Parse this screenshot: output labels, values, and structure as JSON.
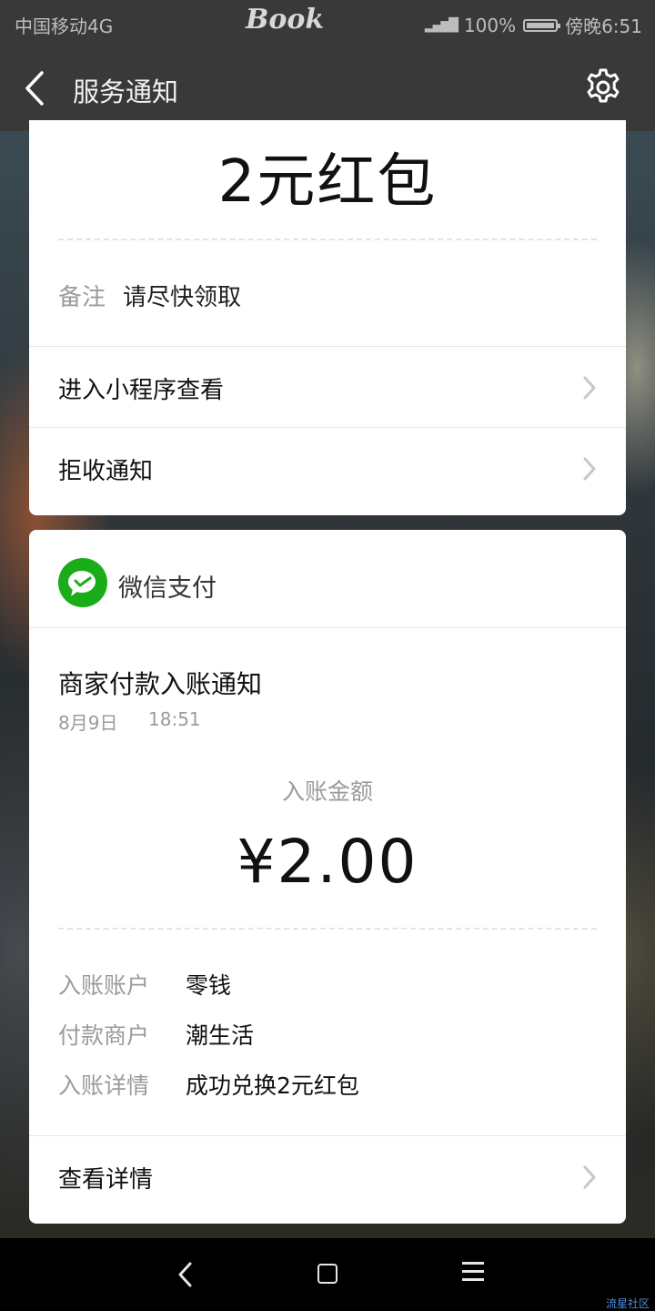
{
  "status_bar": {
    "carrier": "中国移动4G",
    "logo": "Book",
    "battery": "100%",
    "time": "傍晚6:51"
  },
  "title_bar": {
    "title": "服务通知",
    "back_icon": "chevron-left-icon",
    "settings_icon": "gear-icon"
  },
  "card1": {
    "headline": "2元红包",
    "remark_label": "备注",
    "remark_value": "请尽快领取",
    "actions": [
      {
        "label": "进入小程序查看"
      },
      {
        "label": "拒收通知"
      }
    ]
  },
  "card2": {
    "sender": "微信支付",
    "sender_icon": "wechat-pay-icon",
    "title": "商家付款入账通知",
    "date": "8月9日",
    "time": "18:51",
    "amount_label": "入账金额",
    "amount": "¥2.00",
    "details": [
      {
        "label": "入账账户",
        "value": "零钱"
      },
      {
        "label": "付款商户",
        "value": "潮生活"
      },
      {
        "label": "入账详情",
        "value": "成功兑换2元红包"
      }
    ],
    "action_label": "查看详情"
  },
  "watermark": "流星社区",
  "colors": {
    "bar": "#393939",
    "wechat_green": "#1aad19",
    "muted_text": "#9b9b9b"
  }
}
